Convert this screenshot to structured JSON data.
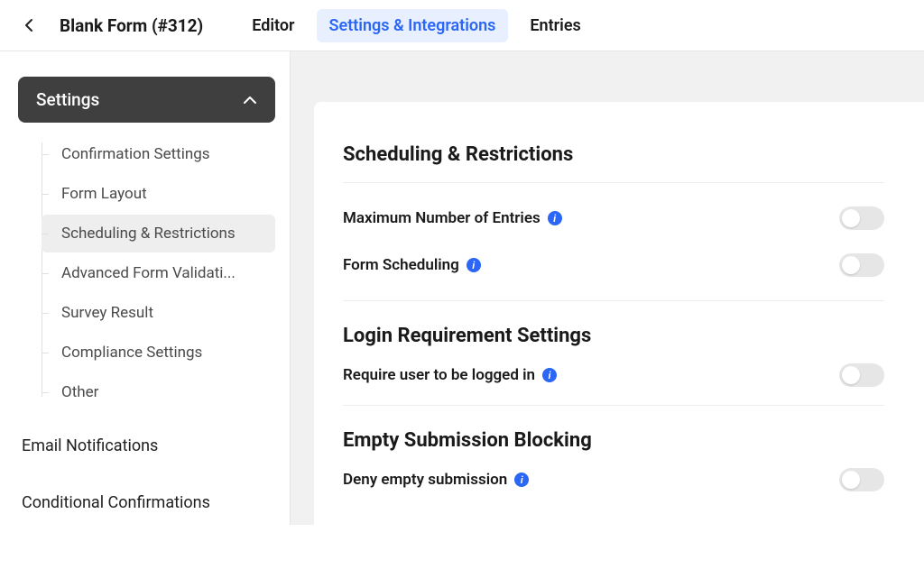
{
  "header": {
    "title": "Blank Form (#312)",
    "tabs": [
      {
        "label": "Editor",
        "active": false
      },
      {
        "label": "Settings & Integrations",
        "active": true
      },
      {
        "label": "Entries",
        "active": false
      }
    ]
  },
  "sidebar": {
    "accordion_label": "Settings",
    "items": [
      {
        "label": "Confirmation Settings",
        "active": false
      },
      {
        "label": "Form Layout",
        "active": false
      },
      {
        "label": "Scheduling & Restrictions",
        "active": true
      },
      {
        "label": "Advanced Form Validati...",
        "active": false
      },
      {
        "label": "Survey Result",
        "active": false
      },
      {
        "label": "Compliance Settings",
        "active": false
      },
      {
        "label": "Other",
        "active": false
      }
    ],
    "links": [
      {
        "label": "Email Notifications"
      },
      {
        "label": "Conditional Confirmations"
      }
    ]
  },
  "main": {
    "sections": [
      {
        "title": "Scheduling & Restrictions",
        "rows": [
          {
            "label": "Maximum Number of Entries",
            "toggle": false
          },
          {
            "label": "Form Scheduling",
            "toggle": false
          }
        ]
      },
      {
        "title": "Login Requirement Settings",
        "rows": [
          {
            "label": "Require user to be logged in",
            "toggle": false
          }
        ]
      },
      {
        "title": "Empty Submission Blocking",
        "rows": [
          {
            "label": "Deny empty submission",
            "toggle": false
          }
        ]
      }
    ]
  }
}
